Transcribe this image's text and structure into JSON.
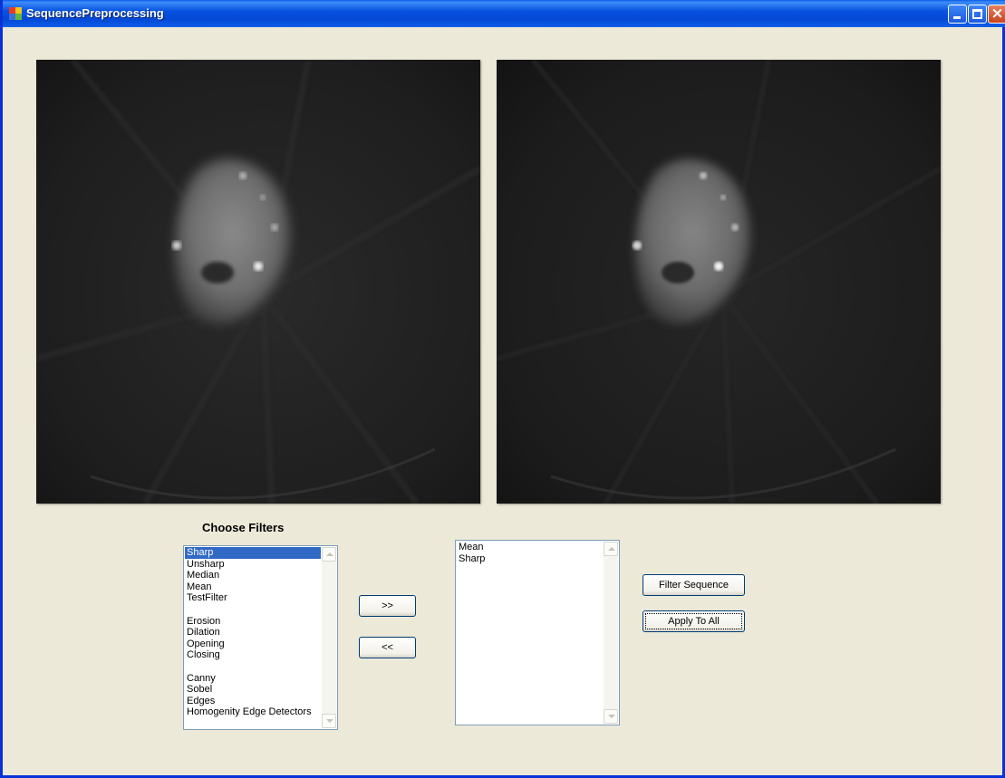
{
  "window": {
    "title": "SequencePreprocessing",
    "controls": {
      "minimize": "minimize",
      "maximize": "maximize",
      "close": "×"
    }
  },
  "images": {
    "original": {
      "icon": "ct-scan-image"
    },
    "processed": {
      "icon": "ct-scan-image"
    }
  },
  "filters": {
    "heading": "Choose Filters",
    "available": [
      "Sharp",
      "Unsharp",
      "Median",
      "Mean",
      "TestFilter",
      "",
      "Erosion",
      "Dilation",
      "Opening",
      "Closing",
      "",
      "Canny",
      "Sobel",
      "Edges",
      "Homogenity Edge Detectors"
    ],
    "selected_index": 0,
    "sequence": [
      "Mean",
      "Sharp"
    ]
  },
  "buttons": {
    "add": ">>",
    "remove": "<<",
    "filter_sequence": "Filter Sequence",
    "apply_to_all": "Apply To All"
  },
  "colors": {
    "titlebar": "#0853e0",
    "window_bg": "#ece9d8",
    "selection": "#316ac5"
  }
}
